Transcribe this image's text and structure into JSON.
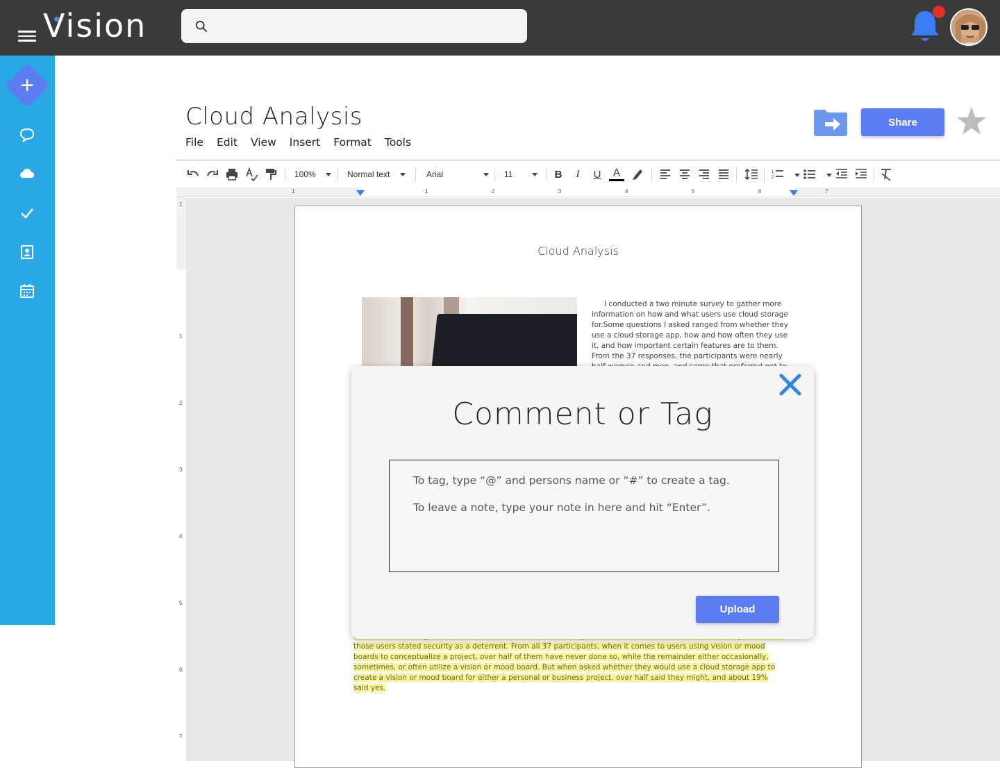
{
  "app": {
    "logo": "Vision"
  },
  "search": {
    "placeholder": "",
    "value": ""
  },
  "document": {
    "title": "Cloud Analysis",
    "menu": [
      "File",
      "Edit",
      "View",
      "Insert",
      "Format",
      "Tools"
    ],
    "share_label": "Share"
  },
  "toolbar": {
    "zoom": "100%",
    "style": "Normal text",
    "font": "Arial",
    "size": "11",
    "bold": "B",
    "italic": "I",
    "underline": "U",
    "text_color": "A"
  },
  "ruler": {
    "horizontal": [
      "1",
      "1",
      "2",
      "3",
      "4",
      "5",
      "6",
      "7"
    ],
    "vertical": [
      "1",
      "1",
      "2",
      "3",
      "4",
      "5",
      "6",
      "7"
    ]
  },
  "page": {
    "heading": "Cloud Analysis",
    "paragraph": "I conducted a two minute survey to gather more information on how and what users use cloud storage for.Some questions I asked ranged from whether they use a cloud storage app, how and how often they use it, and how important certain features are to them. From the 37 responses, the participants were nearly half women and men, and some that preferred not to",
    "highlight_lines": [
      "not use cloud storage, the main reasons stated is because they do not need to, or because it costs money. Not one of",
      "those users stated security as a deterrent. From all 37 participants, when it comes to users using vision or mood",
      "boards to conceptualize a project, over half of them have never done so, while the remainder either occasionally,",
      "sometimes, or often utilize a vision or mood board. But when asked whether they would use a cloud storage app to",
      "create a vision or mood board for either a personal or business project, over half said they might, and about 19%",
      "said yes."
    ]
  },
  "modal": {
    "title": "Comment or Tag",
    "line1": "To  tag, type “@” and persons name or “#” to create a tag.",
    "line2": "To leave a note, type your note in here and hit “Enter”.",
    "upload_label": "Upload"
  },
  "colors": {
    "topbar": "#3a3a3a",
    "sidebar": "#29a8e6",
    "accent": "#5c7cf2",
    "close": "#2f86e8",
    "notification": "#e0302a",
    "highlight": "#fbf59c"
  },
  "icons": {
    "sidebar": [
      "add-icon",
      "chat-icon",
      "cloud-icon",
      "check-icon",
      "contact-icon",
      "calendar-icon"
    ]
  }
}
